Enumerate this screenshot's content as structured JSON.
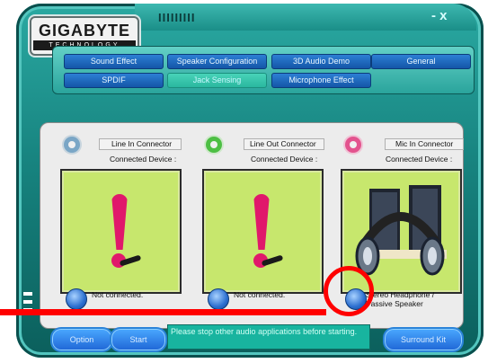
{
  "app": {
    "logo_main": "GIGABYTE",
    "logo_sub": "TECHNOLOGY",
    "grip_text": "IIIIIIIII",
    "window_controls": "- x"
  },
  "tabs": [
    {
      "label": "Sound Effect",
      "active": false
    },
    {
      "label": "Speaker Configuration",
      "active": false
    },
    {
      "label": "3D Audio Demo",
      "active": false
    },
    {
      "label": "General",
      "active": false
    },
    {
      "label": "SPDIF",
      "active": false
    },
    {
      "label": "Jack Sensing",
      "active": true
    },
    {
      "label": "Microphone Effect",
      "active": false
    }
  ],
  "connectors": [
    {
      "title": "Line In Connector",
      "device_label": "Connected Device :",
      "status": "Not connected.",
      "radio_color": "#7aa6c6",
      "icon": "exclamation-icon"
    },
    {
      "title": "Line Out Connector",
      "device_label": "Connected Device :",
      "status": "Not connected.",
      "radio_color": "#4dbf44",
      "icon": "exclamation-icon"
    },
    {
      "title": "Mic In Connector",
      "device_label": "Connected Device :",
      "status": "Stereo Headphone / Passive Speaker",
      "radio_color": "#e3538e",
      "icon": "headphone-speaker-icon"
    }
  ],
  "buttons": {
    "option": "Option",
    "start": "Start",
    "surround": "Surround Kit"
  },
  "message": "Please stop other audio applications before starting.",
  "colors": {
    "accent": "#1f66d6",
    "alert": "#e0186b",
    "card_bg": "#c7e76d",
    "highlight": "#ff0000"
  }
}
